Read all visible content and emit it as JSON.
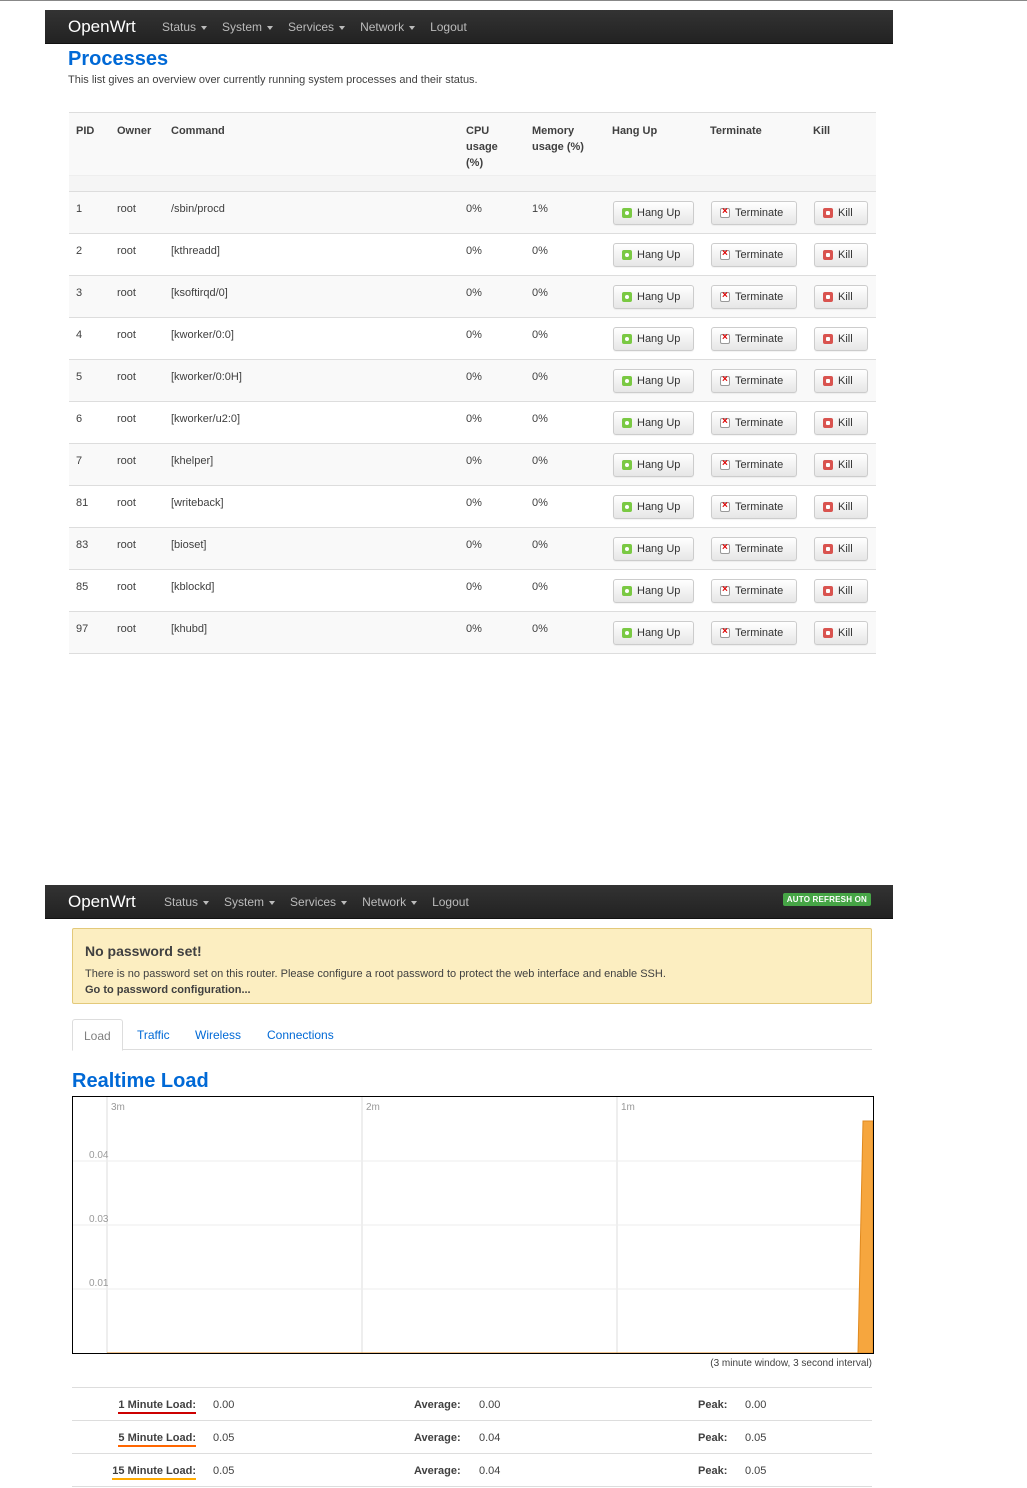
{
  "nav1": {
    "brand": "OpenWrt",
    "menu": [
      "Status",
      "System",
      "Services",
      "Network"
    ],
    "logout": "Logout"
  },
  "processes": {
    "title": "Processes",
    "description": "This list gives an overview over currently running system processes and their status.",
    "headers": {
      "pid": "PID",
      "owner": "Owner",
      "command": "Command",
      "cpu": [
        "CPU",
        "usage",
        "(%)"
      ],
      "mem": [
        "Memory",
        "usage (%)"
      ],
      "hangup": "Hang Up",
      "terminate": "Terminate",
      "kill": "Kill"
    },
    "buttons": {
      "hangup": "Hang Up",
      "terminate": "Terminate",
      "kill": "Kill"
    },
    "rows": [
      {
        "pid": "1",
        "owner": "root",
        "command": "/sbin/procd",
        "cpu": "0%",
        "mem": "1%"
      },
      {
        "pid": "2",
        "owner": "root",
        "command": "[kthreadd]",
        "cpu": "0%",
        "mem": "0%"
      },
      {
        "pid": "3",
        "owner": "root",
        "command": "[ksoftirqd/0]",
        "cpu": "0%",
        "mem": "0%"
      },
      {
        "pid": "4",
        "owner": "root",
        "command": "[kworker/0:0]",
        "cpu": "0%",
        "mem": "0%"
      },
      {
        "pid": "5",
        "owner": "root",
        "command": "[kworker/0:0H]",
        "cpu": "0%",
        "mem": "0%"
      },
      {
        "pid": "6",
        "owner": "root",
        "command": "[kworker/u2:0]",
        "cpu": "0%",
        "mem": "0%"
      },
      {
        "pid": "7",
        "owner": "root",
        "command": "[khelper]",
        "cpu": "0%",
        "mem": "0%"
      },
      {
        "pid": "81",
        "owner": "root",
        "command": "[writeback]",
        "cpu": "0%",
        "mem": "0%"
      },
      {
        "pid": "83",
        "owner": "root",
        "command": "[bioset]",
        "cpu": "0%",
        "mem": "0%"
      },
      {
        "pid": "85",
        "owner": "root",
        "command": "[kblockd]",
        "cpu": "0%",
        "mem": "0%"
      },
      {
        "pid": "97",
        "owner": "root",
        "command": "[khubd]",
        "cpu": "0%",
        "mem": "0%"
      }
    ]
  },
  "nav2": {
    "brand": "OpenWrt",
    "menu": [
      "Status",
      "System",
      "Services",
      "Network"
    ],
    "logout": "Logout",
    "refresh_badge": "AUTO REFRESH ON"
  },
  "alert": {
    "heading": "No password set!",
    "text": "There is no password set on this router. Please configure a root password to protect the web interface and enable SSH.",
    "link": "Go to password configuration..."
  },
  "tabs": [
    "Load",
    "Traffic",
    "Wireless",
    "Connections"
  ],
  "realtime": {
    "title": "Realtime Load",
    "caption": "(3 minute window, 3 second interval)"
  },
  "chart_data": {
    "type": "area",
    "x_labels": [
      "3m",
      "2m",
      "1m"
    ],
    "y_labels": [
      "0.04",
      "0.03",
      "0.01"
    ],
    "ylim": [
      0,
      0.05
    ],
    "grid": true,
    "series": [
      {
        "color": "#f6a63e",
        "x": [
          "3m",
          "2m",
          "1m",
          "0m"
        ],
        "values": [
          0,
          0,
          0,
          0.045
        ]
      }
    ]
  },
  "load": [
    {
      "label": "1 Minute Load:",
      "value": "0.00",
      "avg_label": "Average:",
      "avg": "0.00",
      "peak_label": "Peak:",
      "peak": "0.00",
      "color": "#cc0000"
    },
    {
      "label": "5 Minute Load:",
      "value": "0.05",
      "avg_label": "Average:",
      "avg": "0.04",
      "peak_label": "Peak:",
      "peak": "0.05",
      "color": "#ff6600"
    },
    {
      "label": "15 Minute Load:",
      "value": "0.05",
      "avg_label": "Average:",
      "avg": "0.04",
      "peak_label": "Peak:",
      "peak": "0.05",
      "color": "#ffaa00"
    }
  ]
}
